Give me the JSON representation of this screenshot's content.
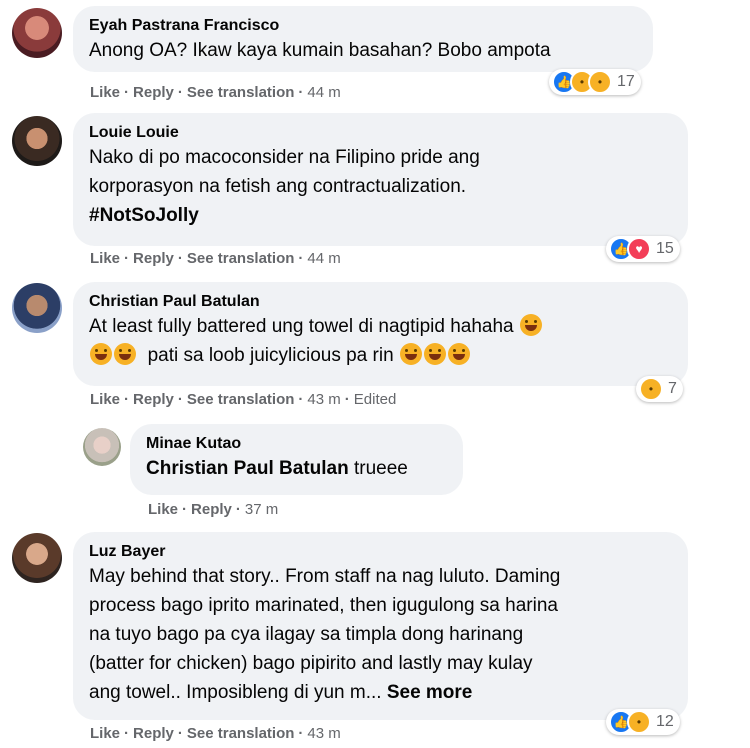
{
  "comments": [
    {
      "author": "Eyah Pastrana Francisco",
      "text": "Anong OA? Ikaw kaya kumain basahan? Bobo ampota",
      "actions": {
        "like": "Like",
        "reply": "Reply",
        "translate": "See translation",
        "time": "44 m"
      },
      "reactions": {
        "icons": [
          "like-icon",
          "haha-icon",
          "sad-icon"
        ],
        "count": "17"
      }
    },
    {
      "author": "Louie Louie",
      "text_line1": "Nako di po macoconsider na Filipino pride ang",
      "text_line2": "korporasyon na fetish ang contractualization.",
      "hashtag": "#NotSoJolly",
      "actions": {
        "like": "Like",
        "reply": "Reply",
        "translate": "See translation",
        "time": "44 m"
      },
      "reactions": {
        "icons": [
          "like-icon",
          "love-icon"
        ],
        "count": "15"
      }
    },
    {
      "author": "Christian Paul Batulan",
      "text_line1": "At least fully battered ung towel di nagtipid hahaha",
      "text_line2": "pati sa loob juicylicious pa rin",
      "actions": {
        "like": "Like",
        "reply": "Reply",
        "translate": "See translation",
        "time": "43 m",
        "edited": "Edited"
      },
      "reactions": {
        "icons": [
          "haha-icon"
        ],
        "count": "7"
      }
    },
    {
      "author": "Minae Kutao",
      "mention": "Christian Paul Batulan",
      "text": "trueee",
      "actions": {
        "like": "Like",
        "reply": "Reply",
        "time": "37 m"
      }
    },
    {
      "author": "Luz Bayer",
      "lines": [
        "May behind that story.. From staff na nag luluto. Daming",
        "process bago iprito marinated, then igugulong sa harina",
        "na tuyo bago pa cya ilagay sa timpla dong harinang",
        "(batter for chicken) bago pipirito and lastly may kulay",
        "ang towel.. Imposibleng di yun m..."
      ],
      "see_more": "See more",
      "actions": {
        "like": "Like",
        "reply": "Reply",
        "translate": "See translation",
        "time": "43 m"
      },
      "reactions": {
        "icons": [
          "like-icon",
          "sad-icon"
        ],
        "count": "12"
      }
    }
  ],
  "colors": {
    "bubble": "#f0f2f5",
    "like": "#1877f2",
    "love": "#f33e58",
    "haha": "#f7b125",
    "meta": "#65676b"
  }
}
